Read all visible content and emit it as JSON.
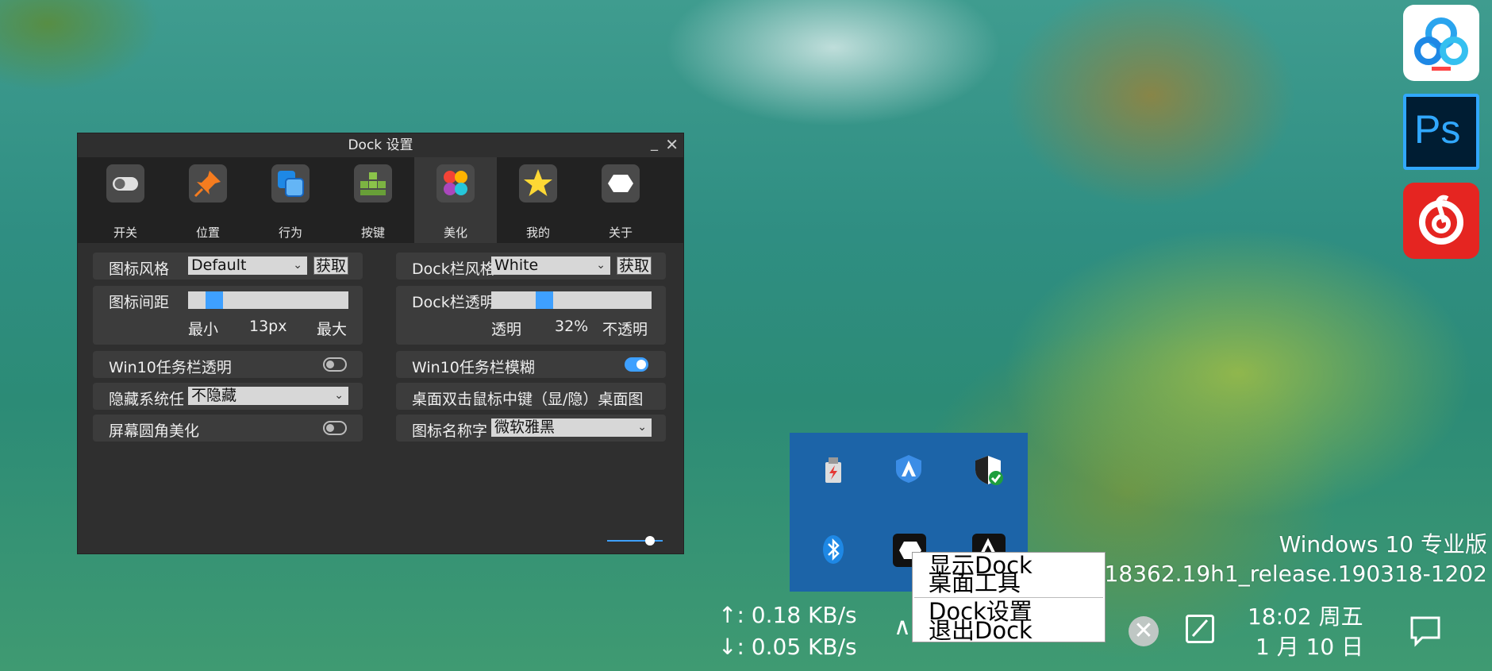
{
  "window": {
    "title": "Dock 设置",
    "minimize": "_",
    "close": "✕",
    "tabs": [
      {
        "label": "开关",
        "icon": "toggle-switch-icon"
      },
      {
        "label": "位置",
        "icon": "pushpin-icon"
      },
      {
        "label": "行为",
        "icon": "overlapping-windows-icon"
      },
      {
        "label": "按键",
        "icon": "keys-blocks-icon"
      },
      {
        "label": "美化",
        "icon": "palette-icon",
        "active": true
      },
      {
        "label": "我的",
        "icon": "star-icon"
      },
      {
        "label": "关于",
        "icon": "hexagon-logo-icon"
      }
    ],
    "left": {
      "icon_style": {
        "label": "图标风格",
        "value": "Default",
        "button": "获取"
      },
      "icon_spacing": {
        "label": "图标间距",
        "min": "最小",
        "value": "13px",
        "max": "最大",
        "fraction": 0.17
      },
      "win10_taskbar_transparent": {
        "label": "Win10任务栏透明",
        "on": false
      },
      "hide_system_tray": {
        "label": "隐藏系统任",
        "value": "不隐藏"
      },
      "screen_corner": {
        "label": "屏幕圆角美化",
        "on": false
      }
    },
    "right": {
      "dock_style": {
        "label": "Dock栏风格",
        "value": "White",
        "button": "获取"
      },
      "dock_opacity": {
        "label": "Dock栏透明",
        "min": "透明",
        "value": "32%",
        "max": "不透明",
        "fraction": 0.32
      },
      "win10_taskbar_blur": {
        "label": "Win10任务栏模糊",
        "on": true
      },
      "desktop_middle_click": {
        "label": "桌面双击鼠标中键（显/隐）桌面图"
      },
      "icon_name_font": {
        "label": "图标名称字",
        "value": "微软雅黑"
      }
    }
  },
  "dock_icons": [
    {
      "name": "baidu-netdisk-icon"
    },
    {
      "name": "photoshop-icon",
      "text": "Ps"
    },
    {
      "name": "netease-music-icon"
    }
  ],
  "tray_icons": [
    "usb-eject-icon",
    "arc-shield-icon",
    "defender-shield-icon",
    "bluetooth-icon",
    "dock-hexagon-icon",
    "vmware-icon"
  ],
  "context_menu": [
    "显示Dock",
    "桌面工具",
    "Dock设置",
    "退出Dock"
  ],
  "watermark": {
    "line1": "Windows 10 专业版",
    "line2": "18362.19h1_release.190318-1202"
  },
  "net": {
    "up": "↑: 0.18 KB/s",
    "down": "↓: 0.05 KB/s"
  },
  "clock": {
    "time": "18:02  周五",
    "date": "1 月 10 日"
  },
  "colors": {
    "accent": "#3ea0ff",
    "window_bg": "#2f2f2f",
    "tray_bg": "#1c64a8"
  }
}
